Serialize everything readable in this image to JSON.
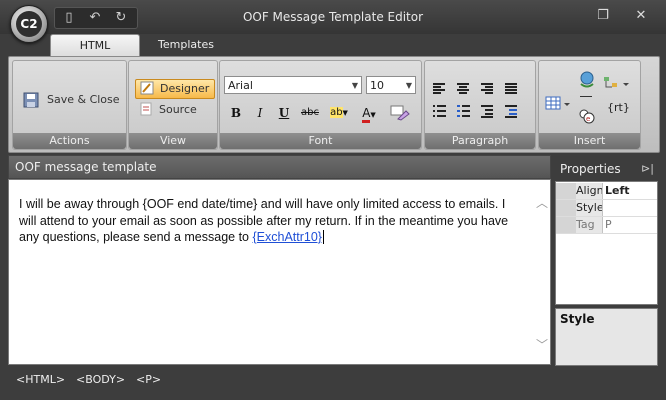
{
  "window": {
    "title": "OOF Message Template Editor",
    "orb_label": "C2"
  },
  "tabs": [
    {
      "label": "HTML",
      "active": true
    },
    {
      "label": "Templates",
      "active": false
    }
  ],
  "ribbon": {
    "actions": {
      "group_label": "Actions",
      "save_close_label": "Save & Close"
    },
    "view": {
      "group_label": "View",
      "designer_label": "Designer",
      "source_label": "Source"
    },
    "font": {
      "group_label": "Font",
      "font_name": "Arial",
      "font_size": "10",
      "bold": "B",
      "italic": "I",
      "underline": "U",
      "strike": "abc",
      "font_color_letter": "A",
      "highlight_letters": "ab"
    },
    "paragraph": {
      "group_label": "Paragraph"
    },
    "insert": {
      "group_label": "Insert",
      "rt_label": "{rt}"
    }
  },
  "editor": {
    "header": "OOF message template",
    "text_before": "I will be away through {OOF end date/time} and will have only limited access to emails. I will attend to your email as soon as possible after my return. If in the meantime you have any questions, please send a message to ",
    "link": "{ExchAttr10}"
  },
  "properties": {
    "header": "Properties",
    "rows": [
      {
        "key": "Align",
        "value": "Left"
      },
      {
        "key": "Style",
        "value": ""
      },
      {
        "key": "Tag",
        "value": "P"
      }
    ],
    "style_label": "Style"
  },
  "statusbar": {
    "crumbs": [
      "<HTML>",
      "<BODY>",
      "<P>"
    ]
  },
  "colors": {
    "accent_orange": "#f7b94a",
    "link_blue": "#1f4fd6",
    "chrome_dark": "#3d3d3d"
  }
}
